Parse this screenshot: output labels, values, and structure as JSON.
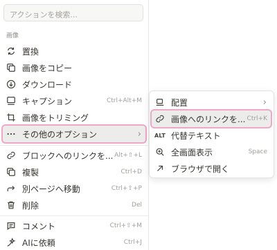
{
  "search": {
    "placeholder": "アクションを検索..."
  },
  "section_title": "画像",
  "menu": {
    "replace": "置換",
    "copy_image": "画像をコピー",
    "download": "ダウンロード",
    "caption": {
      "label": "キャプション",
      "shortcut": "Ctrl+Alt+M"
    },
    "crop": "画像をトリミング",
    "more_options": "その他のオプション",
    "copy_link": {
      "label": "ブロックへのリンクを...",
      "shortcut": "Alt+⇧+L"
    },
    "duplicate": {
      "label": "複製",
      "shortcut": "Ctrl+D"
    },
    "move_to": {
      "label": "別ページへ移動",
      "shortcut": "Ctrl+⇧+P"
    },
    "delete": {
      "label": "削除",
      "shortcut": "Del"
    },
    "comment": {
      "label": "コメント",
      "shortcut": "Ctrl+⇧+M"
    },
    "ask_ai": {
      "label": "AIに依頼",
      "shortcut": "Ctrl+J"
    }
  },
  "submenu": {
    "align": "配置",
    "link_to_image": {
      "label": "画像へのリンクを...",
      "shortcut": "Ctrl+K"
    },
    "alt_badge": "ALT",
    "alt_text": "代替テキスト",
    "fullscreen": {
      "label": "全画面表示",
      "shortcut": "Space"
    },
    "open_in_browser": "ブラウザで開く"
  },
  "colors": {
    "highlight_outline": "#f0a6c8",
    "selected_bg": "#ececea"
  },
  "icons": [
    "replace-icon",
    "copy-icon",
    "download-icon",
    "caption-icon",
    "crop-icon",
    "more-icon",
    "link-icon",
    "duplicate-icon",
    "arrow-right-icon",
    "trash-icon",
    "comment-icon",
    "ai-icon",
    "align-icon",
    "image-link-icon",
    "zoom-icon",
    "external-arrow-icon"
  ]
}
